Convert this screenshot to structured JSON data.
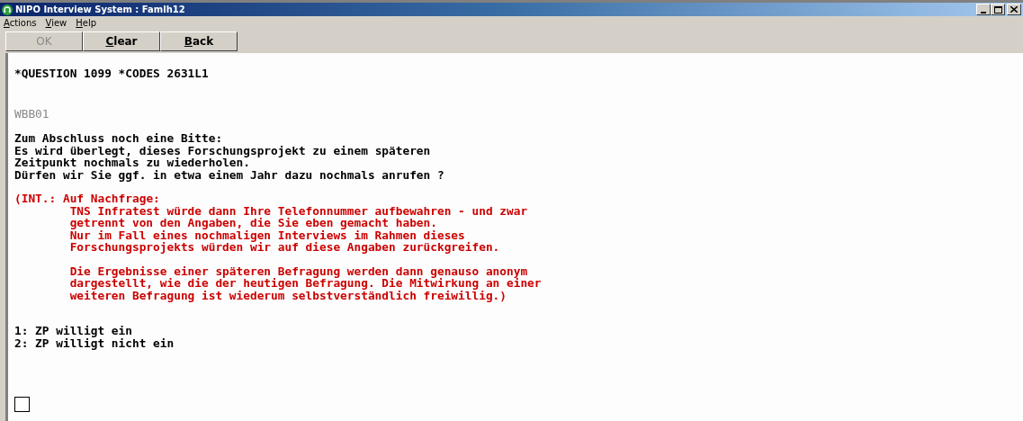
{
  "window": {
    "title": "NIPO Interview System : Famlh12"
  },
  "menu": [
    "Actions",
    "View",
    "Help"
  ],
  "buttons": [
    {
      "label": "OK",
      "disabled": true,
      "accel": false
    },
    {
      "label": "Clear",
      "disabled": false,
      "accel": true
    },
    {
      "label": "Back",
      "disabled": false,
      "accel": true
    }
  ],
  "header": "*QUESTION 1099 *CODES 2631L1",
  "code": "WBB01",
  "question": [
    "Zum Abschluss noch eine Bitte:",
    "Es wird überlegt, dieses Forschungsprojekt zu einem späteren",
    "Zeitpunkt nochmals zu wiederholen.",
    "Dürfen wir Sie ggf. in etwa einem Jahr dazu nochmals anrufen ?"
  ],
  "instruction": {
    "lead": "(INT.: Auf Nachfrage:",
    "paragraphs": [
      [
        "TNS Infratest würde dann Ihre Telefonnummer aufbewahren - und zwar",
        "getrennt von den Angaben, die Sie eben gemacht haben.",
        "Nur im Fall eines nochmaligen Interviews im Rahmen dieses",
        "Forschungsprojekts würden wir auf diese Angaben zurückgreifen."
      ],
      [
        "Die Ergebnisse einer späteren Befragung werden dann genauso anonym",
        "dargestellt, wie die der heutigen Befragung. Die Mitwirkung an einer",
        "weiteren Befragung ist wiederum selbstverständlich freiwillig.)"
      ]
    ]
  },
  "options": [
    "1: ZP willigt ein",
    "2: ZP willigt nicht ein"
  ]
}
